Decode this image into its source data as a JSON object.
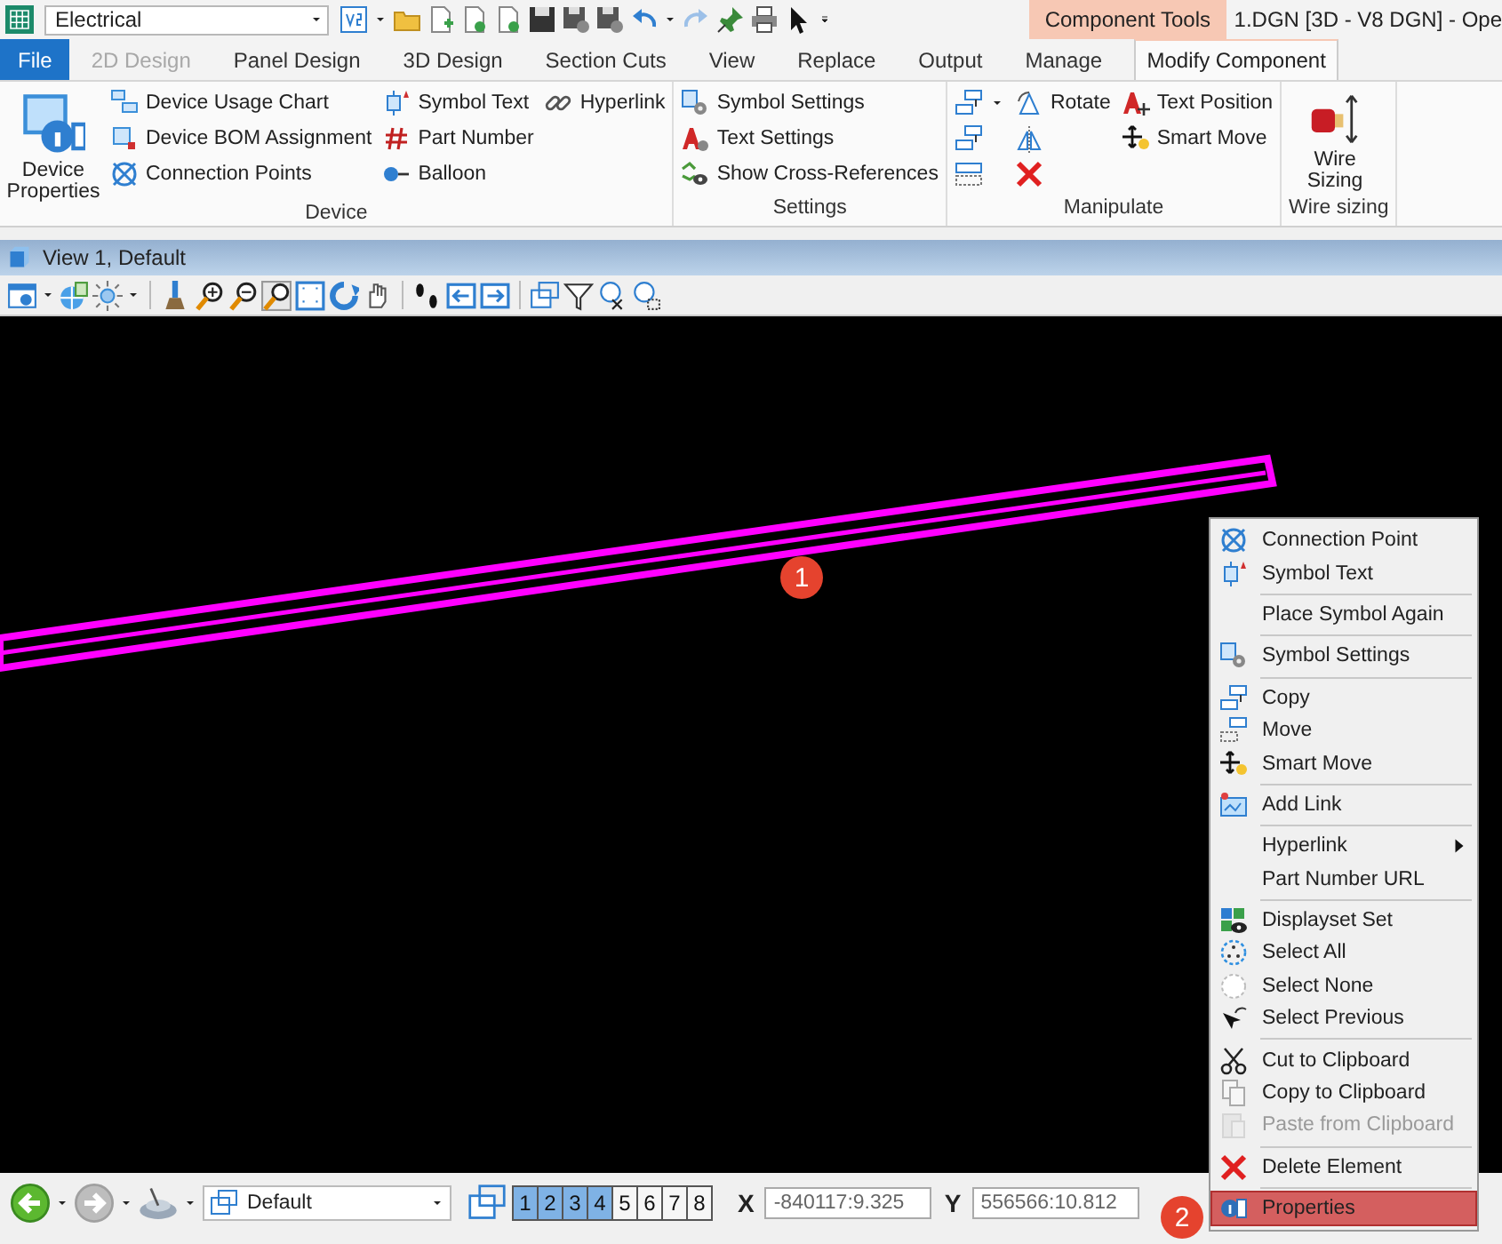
{
  "toolbar": {
    "workspace": "Electrical"
  },
  "contextual_tab_group": "Component Tools",
  "document_title": "1.DGN [3D - V8 DGN] - Ope",
  "tabs": [
    {
      "label": "File",
      "kind": "file",
      "selected": false,
      "disabled": false
    },
    {
      "label": "2D Design",
      "kind": "tab",
      "selected": false,
      "disabled": true
    },
    {
      "label": "Panel Design",
      "kind": "tab",
      "selected": false,
      "disabled": false
    },
    {
      "label": "3D Design",
      "kind": "tab",
      "selected": false,
      "disabled": false
    },
    {
      "label": "Section Cuts",
      "kind": "tab",
      "selected": false,
      "disabled": false
    },
    {
      "label": "View",
      "kind": "tab",
      "selected": false,
      "disabled": false
    },
    {
      "label": "Replace",
      "kind": "tab",
      "selected": false,
      "disabled": false
    },
    {
      "label": "Output",
      "kind": "tab",
      "selected": false,
      "disabled": false
    },
    {
      "label": "Manage",
      "kind": "tab",
      "selected": false,
      "disabled": false
    },
    {
      "label": "Modify Component",
      "kind": "contextual",
      "selected": true,
      "disabled": false
    }
  ],
  "ribbon_groups": [
    {
      "label": "Device",
      "columns": [
        [
          {
            "kind": "large",
            "label": "Device Properties"
          }
        ],
        [
          {
            "kind": "small",
            "label": "Device Usage Chart"
          },
          {
            "kind": "small",
            "label": "Device BOM Assignment"
          },
          {
            "kind": "small",
            "label": "Connection Points"
          }
        ],
        [
          {
            "kind": "small",
            "label": "Symbol Text"
          },
          {
            "kind": "small",
            "label": "Part Number"
          },
          {
            "kind": "small",
            "label": "Balloon"
          }
        ],
        [
          {
            "kind": "small",
            "label": "Hyperlink"
          }
        ]
      ]
    },
    {
      "label": "Settings",
      "columns": [
        [
          {
            "kind": "small",
            "label": "Symbol Settings"
          },
          {
            "kind": "small",
            "label": "Text Settings"
          },
          {
            "kind": "small",
            "label": "Show Cross-References"
          }
        ]
      ]
    },
    {
      "label": "Manipulate",
      "columns": [
        [
          {
            "kind": "split"
          },
          {
            "kind": "icon"
          },
          {
            "kind": "icon"
          }
        ],
        [
          {
            "kind": "small",
            "label": "Rotate"
          },
          {
            "kind": "icon"
          },
          {
            "kind": "icon"
          }
        ],
        [
          {
            "kind": "small",
            "label": "Text Position"
          },
          {
            "kind": "small",
            "label": "Smart Move"
          }
        ]
      ]
    },
    {
      "label": "Wire sizing",
      "columns": [
        [
          {
            "kind": "large",
            "label": "Wire Sizing"
          }
        ]
      ]
    }
  ],
  "view": {
    "title": "View 1, Default"
  },
  "annotations": [
    "1",
    "2"
  ],
  "context_menu": {
    "sections": [
      [
        {
          "label": "Connection Point",
          "selected": false,
          "disabled": false,
          "submenu": false
        },
        {
          "label": "Symbol Text",
          "selected": false,
          "disabled": false,
          "submenu": false
        }
      ],
      [
        {
          "label": "Place Symbol Again",
          "selected": false,
          "disabled": false,
          "submenu": false
        }
      ],
      [
        {
          "label": "Symbol Settings",
          "selected": false,
          "disabled": false,
          "submenu": false
        }
      ],
      [
        {
          "label": "Copy",
          "selected": false,
          "disabled": false,
          "submenu": false
        },
        {
          "label": "Move",
          "selected": false,
          "disabled": false,
          "submenu": false
        },
        {
          "label": "Smart Move",
          "selected": false,
          "disabled": false,
          "submenu": false
        }
      ],
      [
        {
          "label": "Add Link",
          "selected": false,
          "disabled": false,
          "submenu": false
        }
      ],
      [
        {
          "label": "Hyperlink",
          "selected": false,
          "disabled": false,
          "submenu": true
        },
        {
          "label": "Part Number URL",
          "selected": false,
          "disabled": false,
          "submenu": false
        }
      ],
      [
        {
          "label": "Displayset Set",
          "selected": false,
          "disabled": false,
          "submenu": false
        },
        {
          "label": "Select All",
          "selected": false,
          "disabled": false,
          "submenu": false
        },
        {
          "label": "Select None",
          "selected": false,
          "disabled": false,
          "submenu": false
        },
        {
          "label": "Select Previous",
          "selected": false,
          "disabled": false,
          "submenu": false
        }
      ],
      [
        {
          "label": "Cut to Clipboard",
          "selected": false,
          "disabled": false,
          "submenu": false
        },
        {
          "label": "Copy to Clipboard",
          "selected": false,
          "disabled": false,
          "submenu": false
        },
        {
          "label": "Paste from Clipboard",
          "selected": false,
          "disabled": true,
          "submenu": false
        }
      ],
      [
        {
          "label": "Delete Element",
          "selected": false,
          "disabled": false,
          "submenu": false
        }
      ],
      [
        {
          "label": "Properties",
          "selected": true,
          "disabled": false,
          "submenu": false
        }
      ]
    ]
  },
  "status_bar": {
    "view_group": "Default",
    "views": [
      {
        "label": "1",
        "selected": true
      },
      {
        "label": "2",
        "selected": true
      },
      {
        "label": "3",
        "selected": true
      },
      {
        "label": "4",
        "selected": true
      },
      {
        "label": "5",
        "selected": false
      },
      {
        "label": "6",
        "selected": false
      },
      {
        "label": "7",
        "selected": false
      },
      {
        "label": "8",
        "selected": false
      }
    ],
    "x": {
      "label": "X",
      "value": "-840117:9.325"
    },
    "y": {
      "label": "Y",
      "value": "556566:10.812"
    }
  }
}
